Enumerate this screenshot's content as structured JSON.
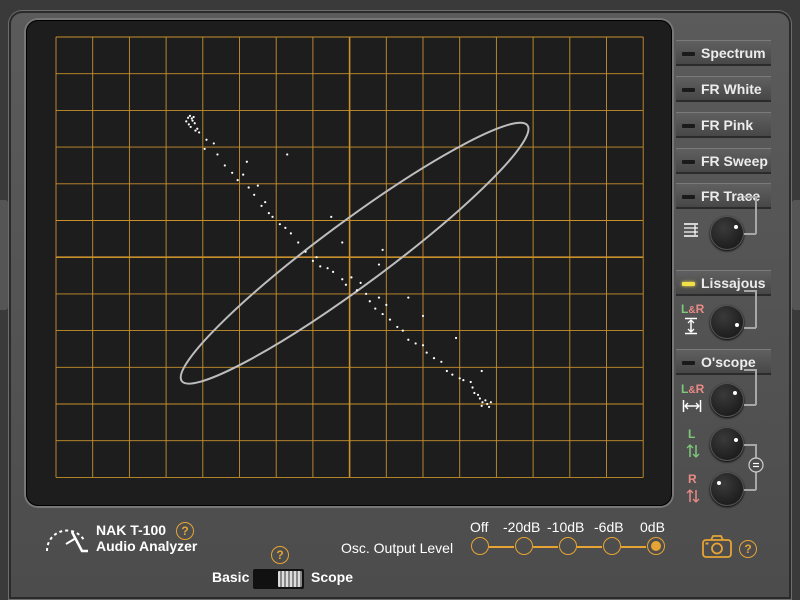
{
  "device": {
    "model": "NAK T-100",
    "subtitle": "Audio Analyzer"
  },
  "modes": [
    {
      "label": "Spectrum",
      "active": false
    },
    {
      "label": "FR White",
      "active": false
    },
    {
      "label": "FR Pink",
      "active": false
    },
    {
      "label": "FR Sweep",
      "active": false
    },
    {
      "label": "FR Trace",
      "active": false
    },
    {
      "label": "Lissajous",
      "active": true
    },
    {
      "label": "O'scope",
      "active": false
    }
  ],
  "knob_labels": {
    "lissajous_l": "L",
    "lissajous_amp": "&",
    "lissajous_r": "R",
    "oscope_l1": "L",
    "oscope_amp": "&",
    "oscope_r1": "R",
    "oscope_l2": "L",
    "oscope_r2": "R"
  },
  "osc_output": {
    "title": "Osc. Output Level",
    "levels": [
      "Off",
      "-20dB",
      "-10dB",
      "-6dB",
      "0dB"
    ],
    "selected": "0dB"
  },
  "view_switch": {
    "left_label": "Basic",
    "right_label": "Scope",
    "state": "Scope"
  },
  "help_symbol": "?",
  "colors": {
    "grid": "#c8902c",
    "trace": "#ffffff",
    "ellipse": "#bdbdbd",
    "accent": "#e6a434",
    "led_on": "#f1e04a",
    "left_channel": "#7ec87a",
    "right_channel": "#e98a86"
  },
  "icons": [
    "scale-arrows-icon",
    "camera-icon",
    "help-icon",
    "logo-arc-icon",
    "equals-icon"
  ],
  "lissajous_points": [
    [
      4.25,
      2.18
    ],
    [
      4.3,
      2.22
    ],
    [
      4.35,
      2.15
    ],
    [
      4.4,
      2.2
    ],
    [
      4.28,
      2.28
    ],
    [
      4.45,
      2.3
    ],
    [
      4.22,
      2.35
    ],
    [
      4.38,
      2.38
    ],
    [
      4.33,
      2.45
    ],
    [
      4.15,
      2.5
    ],
    [
      4.1,
      2.6
    ],
    [
      4.2,
      2.55
    ],
    [
      3.9,
      2.8
    ],
    [
      3.7,
      2.9
    ],
    [
      3.95,
      3.05
    ],
    [
      3.6,
      3.2
    ],
    [
      3.4,
      3.5
    ],
    [
      3.2,
      3.7
    ],
    [
      3.05,
      3.9
    ],
    [
      2.9,
      3.75
    ],
    [
      2.75,
      4.1
    ],
    [
      2.6,
      4.3
    ],
    [
      2.5,
      4.05
    ],
    [
      2.4,
      4.6
    ],
    [
      2.3,
      4.5
    ],
    [
      2.2,
      4.8
    ],
    [
      2.1,
      4.9
    ],
    [
      1.9,
      5.1
    ],
    [
      1.75,
      5.2
    ],
    [
      1.6,
      5.35
    ],
    [
      1.4,
      5.6
    ],
    [
      1.2,
      5.85
    ],
    [
      1.0,
      6.1
    ],
    [
      0.9,
      6.0
    ],
    [
      0.8,
      6.25
    ],
    [
      0.6,
      6.3
    ],
    [
      0.45,
      6.4
    ],
    [
      0.2,
      6.6
    ],
    [
      0.1,
      6.75
    ],
    [
      -0.05,
      6.55
    ],
    [
      -0.2,
      6.9
    ],
    [
      -0.3,
      6.7
    ],
    [
      -0.45,
      7.0
    ],
    [
      -0.55,
      7.2
    ],
    [
      -0.7,
      7.4
    ],
    [
      -0.8,
      7.1
    ],
    [
      -0.9,
      7.55
    ],
    [
      -1.0,
      7.3
    ],
    [
      -1.1,
      7.7
    ],
    [
      -1.3,
      7.9
    ],
    [
      -1.45,
      8.0
    ],
    [
      -1.6,
      8.25
    ],
    [
      -1.8,
      8.35
    ],
    [
      -2.0,
      8.4
    ],
    [
      -2.1,
      8.6
    ],
    [
      -2.3,
      8.75
    ],
    [
      -2.5,
      8.85
    ],
    [
      -2.65,
      9.1
    ],
    [
      -2.8,
      9.2
    ],
    [
      -3.0,
      9.3
    ],
    [
      -3.1,
      9.35
    ],
    [
      -3.3,
      9.4
    ],
    [
      -3.35,
      9.55
    ],
    [
      -3.4,
      9.7
    ],
    [
      -3.5,
      9.75
    ],
    [
      -3.55,
      9.85
    ],
    [
      -3.62,
      9.95
    ],
    [
      -3.7,
      9.9
    ],
    [
      -3.75,
      10.0
    ],
    [
      -3.6,
      10.05
    ],
    [
      -3.8,
      10.08
    ],
    [
      -3.85,
      9.95
    ],
    [
      -1.6,
      7.1
    ],
    [
      -0.9,
      5.8
    ],
    [
      0.2,
      5.6
    ],
    [
      0.5,
      4.9
    ],
    [
      -0.8,
      6.2
    ],
    [
      1.7,
      3.2
    ],
    [
      2.8,
      3.4
    ],
    [
      -2.9,
      8.2
    ],
    [
      -3.6,
      9.1
    ],
    [
      -2.0,
      7.6
    ]
  ]
}
